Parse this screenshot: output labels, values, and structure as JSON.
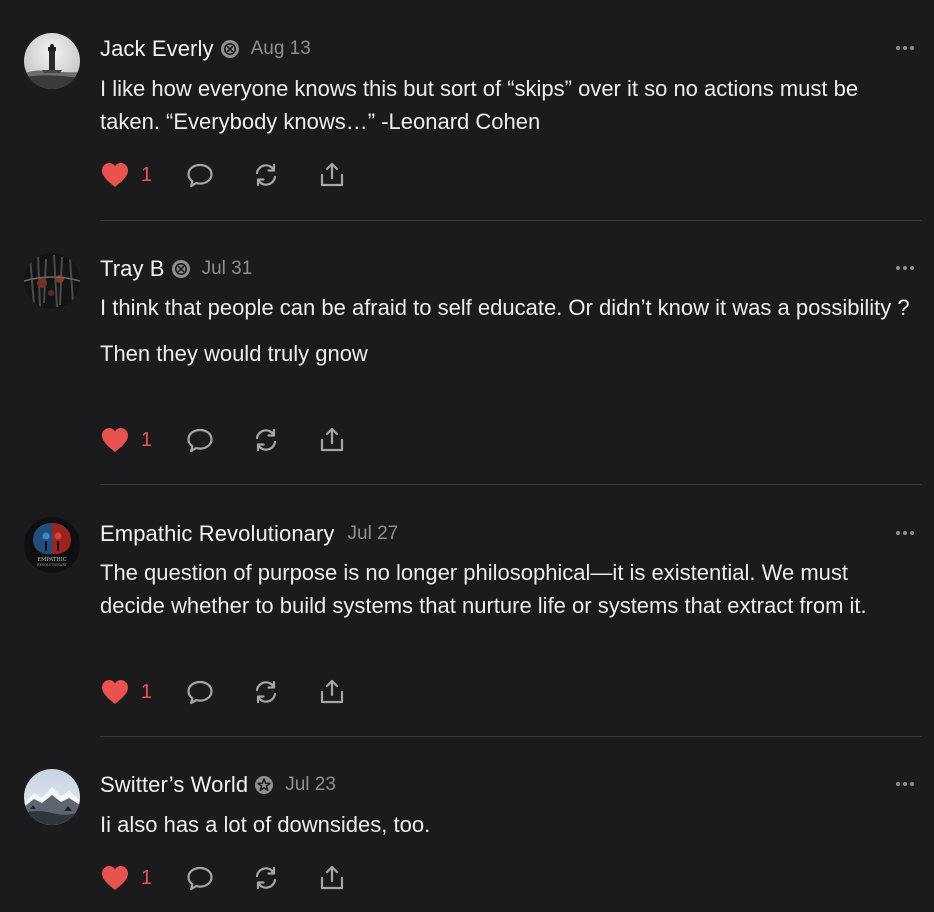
{
  "colors": {
    "background": "#1b1b1d",
    "text": "#ececec",
    "muted": "#8e8e93",
    "like": "#e8524f",
    "icon": "#a5a5aa",
    "divider": "#38383b"
  },
  "comments": [
    {
      "author": "Jack Everly",
      "date": "Aug 13",
      "paragraphs": [
        "I like how everyone knows this but sort of “skips” over it so no actions must be taken. “Everybody knows…” -Leonard Cohen"
      ],
      "likes": "1",
      "avatar": "lighthouse-photo",
      "badge": "subscriber-badge-icon"
    },
    {
      "author": "Tray B",
      "date": "Jul 31",
      "paragraphs": [
        "I think that people can be afraid to self educate. Or didn’t know it was a possibility ?",
        "Then they would truly gnow"
      ],
      "likes": "1",
      "avatar": "dark-abstract-photo",
      "badge": "subscriber-badge-icon"
    },
    {
      "author": "Empathic Revolutionary",
      "date": "Jul 27",
      "paragraphs": [
        "The question of purpose is no longer philosophical—it is existential. We must decide whether to build systems that nurture life or systems that extract from it."
      ],
      "likes": "1",
      "avatar": "empathic-logo",
      "avatar_text": [
        "EMPATHIC",
        "REVOLUTIONARY"
      ]
    },
    {
      "author": "Switter’s World",
      "date": "Jul 23",
      "paragraphs": [
        "Ii also has a lot of downsides, too."
      ],
      "likes": "1",
      "avatar": "snowy-mountain-photo",
      "badge": "subscriber-badge-icon"
    }
  ]
}
